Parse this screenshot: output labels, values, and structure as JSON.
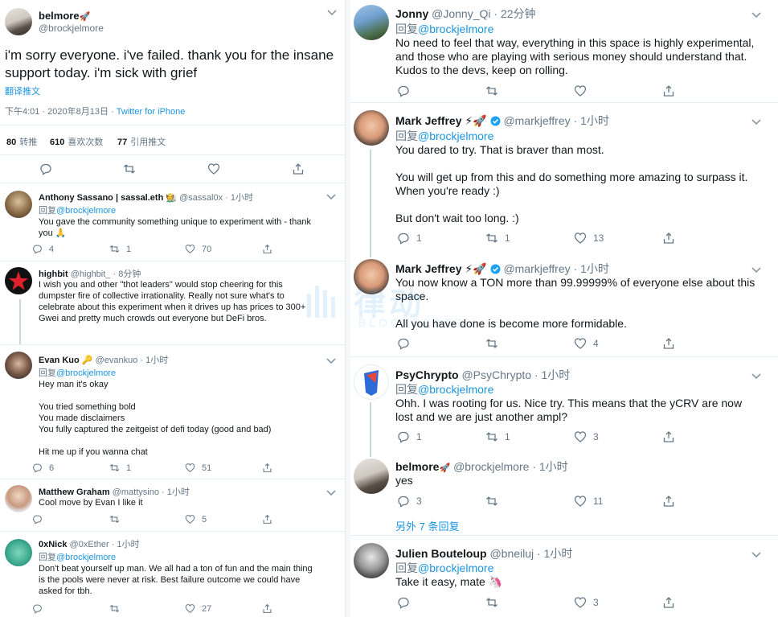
{
  "main_tweet": {
    "name": "belmore",
    "name_emoji": "🚀",
    "handle": "@brockjelmore",
    "text": "i'm sorry everyone. i've failed. thank you for the insane support today. i'm sick with grief",
    "translate_label": "翻译推文",
    "time": "下午4:01 · 2020年8月13日 · ",
    "source": "Twitter for iPhone",
    "stats": {
      "retweets": "80",
      "retweets_label": "转推",
      "likes": "610",
      "likes_label": "喜欢次数",
      "quotes": "77",
      "quotes_label": "引用推文"
    }
  },
  "left_replies": [
    {
      "name": "Anthony Sassano | sassal.eth",
      "emoji": "🧑‍🌾",
      "handle": "@sassal0x",
      "time": "· 1小时",
      "reply_prefix": "回复",
      "reply_to": "@brockjelmore",
      "text": "You gave the community something unique to experiment with - thank you 🙏",
      "replies": "4",
      "retweets": "1",
      "likes": "70"
    },
    {
      "name": "highbit",
      "handle": "@highbit_",
      "time": "· 8分钟",
      "text": "I wish you and other \"thot leaders\" would stop cheering for this dumpster fire of collective irrationality. Really not sure what's to celebrate about this experiment when it drives up has prices to 300+ Gwei and pretty much crowds out everyone but DeFi bros."
    },
    {
      "name": "Evan Kuo",
      "emoji": "🔑",
      "handle": "@evankuo",
      "time": "· 1小时",
      "reply_prefix": "回复",
      "reply_to": "@brockjelmore",
      "text": "Hey man it's okay\n\nYou tried something bold\nYou made disclaimers\nYou fully captured the zeitgeist of defi today (good and bad)\n\nHit me up if you wanna chat",
      "replies": "6",
      "retweets": "1",
      "likes": "51"
    },
    {
      "name": "Matthew Graham",
      "handle": "@mattysino",
      "time": "· 1小时",
      "text": "Cool move by Evan I like it",
      "likes": "5"
    },
    {
      "name": "0xNick",
      "handle": "@0xEther",
      "time": "· 1小时",
      "reply_prefix": "回复",
      "reply_to": "@brockjelmore",
      "text": "Don't beat yourself up man. We all had a ton of fun and the main thing is the pools were never at risk. Best failure outcome we could have asked for tbh.",
      "likes": "27"
    }
  ],
  "right_replies": [
    {
      "name": "Jonny",
      "handle": "@Jonny_Qi",
      "time": "· 22分钟",
      "reply_prefix": "回复",
      "reply_to": "@brockjelmore",
      "text": "No need to feel that way, everything in this space is highly experimental, and those who are playing with serious money should understand that. Kudos to the devs, keep on rolling."
    },
    {
      "name": "Mark Jeffrey",
      "emoji": "⚡🚀",
      "handle": "@markjeffrey",
      "time": "· 1小时",
      "reply_prefix": "回复",
      "reply_to": "@brockjelmore",
      "text": "You dared to try. That is braver than most.\n\nYou will get up from this and do something more amazing to surpass it.  When you're ready :)\n\nBut don't wait too long. :)",
      "replies": "1",
      "retweets": "1",
      "likes": "13"
    },
    {
      "name": "Mark Jeffrey",
      "emoji": "⚡🚀",
      "handle": "@markjeffrey",
      "time": "· 1小时",
      "text": "You now know a TON more than 99.99999% of everyone else about this space.\n\nAll you have done is become more formidable.",
      "likes": "4"
    },
    {
      "name": "PsyChrypto",
      "handle": "@PsyChrypto",
      "time": "· 1小时",
      "reply_prefix": "回复",
      "reply_to": "@brockjelmore",
      "text": "Ohh. I was rooting for us. Nice try. This means that the yCRV are now lost and we are just another ampl?",
      "replies": "1",
      "retweets": "1",
      "likes": "3"
    },
    {
      "name": "belmore",
      "emoji": "🚀",
      "handle": "@brockjelmore",
      "time": "· 1小时",
      "text": "yes",
      "replies": "3",
      "likes": "11"
    },
    {
      "more_label": "另外 7 条回复"
    },
    {
      "name": "Julien Bouteloup",
      "handle": "@bneiluj",
      "time": "· 1小时",
      "reply_prefix": "回复",
      "reply_to": "@brockjelmore",
      "text": "Take it easy, mate 🦄",
      "likes": "3"
    }
  ],
  "watermark": {
    "text": "律动",
    "subtext": "BLOCKBEATS"
  },
  "colors": {
    "link": "#1b95e0",
    "muted": "#657786",
    "border": "#e6ecf0",
    "verified": "#1da1f2"
  }
}
